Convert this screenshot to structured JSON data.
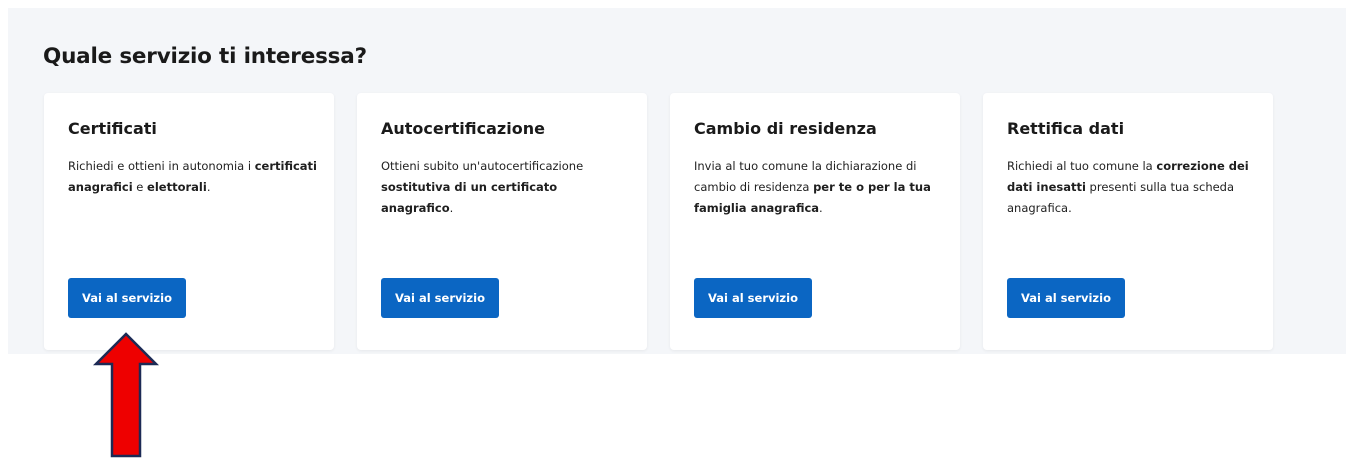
{
  "section": {
    "title": "Quale servizio ti interessa?"
  },
  "cards": [
    {
      "title": "Certificati",
      "description": [
        {
          "text": "Richiedi e ottieni in autonomia i ",
          "bold": false
        },
        {
          "text": "certificati anagrafici",
          "bold": true
        },
        {
          "text": " e ",
          "bold": false
        },
        {
          "text": "elettorali",
          "bold": true
        },
        {
          "text": ".",
          "bold": false
        }
      ],
      "button_label": "Vai al servizio"
    },
    {
      "title": "Autocertificazione",
      "description": [
        {
          "text": "Ottieni subito un'autocertificazione ",
          "bold": false
        },
        {
          "text": "sostitutiva di un certificato anagrafico",
          "bold": true
        },
        {
          "text": ".",
          "bold": false
        }
      ],
      "button_label": "Vai al servizio"
    },
    {
      "title": "Cambio di residenza",
      "description": [
        {
          "text": "Invia al tuo comune la dichiarazione di cambio di residenza ",
          "bold": false
        },
        {
          "text": "per te o per la tua famiglia anagrafica",
          "bold": true
        },
        {
          "text": ".",
          "bold": false
        }
      ],
      "button_label": "Vai al servizio"
    },
    {
      "title": "Rettifica dati",
      "description": [
        {
          "text": "Richiedi al tuo comune la ",
          "bold": false
        },
        {
          "text": "correzione dei dati inesatti",
          "bold": true
        },
        {
          "text": " presenti sulla tua scheda anagrafica.",
          "bold": false
        }
      ],
      "button_label": "Vai al servizio"
    }
  ],
  "colors": {
    "section_background": "#f4f6f9",
    "button": "#0b66c3",
    "arrow_fill": "#ee0000",
    "arrow_stroke": "#1c2a55"
  },
  "annotation": {
    "icon": "up-arrow-icon"
  }
}
